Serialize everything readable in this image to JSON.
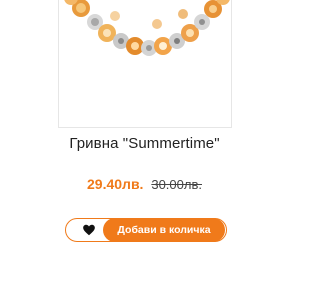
{
  "product": {
    "title": "Гривна \"Summertime\"",
    "image_alt": "bracelet-image",
    "price_current": "29.40лв.",
    "price_old": "30.00лв."
  },
  "actions": {
    "wishlist_icon": "heart-icon",
    "add_to_cart_label": "Добави в количка"
  },
  "colors": {
    "accent": "#f07a1a",
    "text": "#222222",
    "border": "#e6e6e6"
  }
}
